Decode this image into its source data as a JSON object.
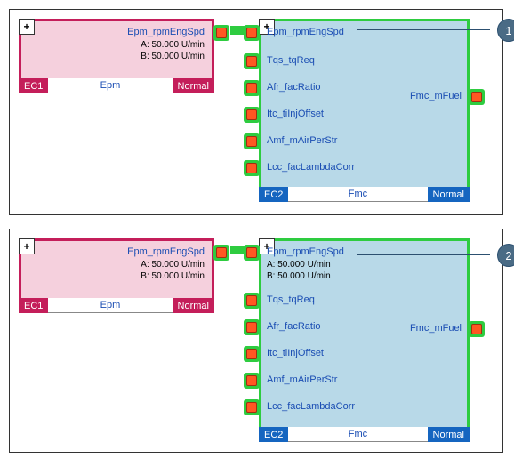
{
  "panels": [
    {
      "callout": "1",
      "ec1": {
        "id": "EC1",
        "name": "Epm",
        "status": "Normal",
        "outSignal": "Epm_rpmEngSpd",
        "detailA": "A: 50.000 U/min",
        "detailB": "B: 50.000 U/min"
      },
      "ec2": {
        "id": "EC2",
        "name": "Fmc",
        "status": "Normal",
        "inputs": [
          {
            "label": "Epm_rpmEngSpd",
            "detailA": "",
            "detailB": ""
          },
          {
            "label": "Tqs_tqReq"
          },
          {
            "label": "Afr_facRatio"
          },
          {
            "label": "Itc_tiInjOffset"
          },
          {
            "label": "Amf_mAirPerStr"
          },
          {
            "label": "Lcc_facLambdaCorr"
          }
        ],
        "output": "Fmc_mFuel"
      }
    },
    {
      "callout": "2",
      "ec1": {
        "id": "EC1",
        "name": "Epm",
        "status": "Normal",
        "outSignal": "Epm_rpmEngSpd",
        "detailA": "A: 50.000 U/min",
        "detailB": "B: 50.000 U/min"
      },
      "ec2": {
        "id": "EC2",
        "name": "Fmc",
        "status": "Normal",
        "inputs": [
          {
            "label": "Epm_rpmEngSpd",
            "detailA": "A: 50.000 U/min",
            "detailB": "B: 50.000 U/min"
          },
          {
            "label": "Tqs_tqReq"
          },
          {
            "label": "Afr_facRatio"
          },
          {
            "label": "Itc_tiInjOffset"
          },
          {
            "label": "Amf_mAirPerStr"
          },
          {
            "label": "Lcc_facLambdaCorr"
          }
        ],
        "output": "Fmc_mFuel"
      }
    }
  ],
  "icons": {
    "plus": "+"
  }
}
